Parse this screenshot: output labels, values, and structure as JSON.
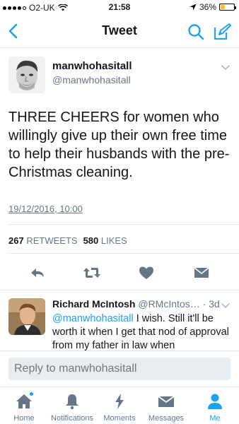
{
  "status_bar": {
    "carrier": "O2-UK",
    "time": "21:58",
    "battery": "36%",
    "battery_level": 0.36
  },
  "nav": {
    "title": "Tweet",
    "back_icon": "chevron-left-icon",
    "search_icon": "search-icon",
    "compose_icon": "compose-icon"
  },
  "tweet": {
    "name": "manwhohasitall",
    "handle": "@manwhohasitall",
    "text": "THREE CHEERS for women who willingly give up their own free time to help their husbands with the pre-Christmas cleaning.",
    "date": "19/12/2016, 10:00",
    "retweets_count": "267",
    "retweets_label": "RETWEETS",
    "likes_count": "580",
    "likes_label": "LIKES"
  },
  "reply": {
    "name": "Richard McIntosh",
    "handle": "@RMcIntos…",
    "time": "· 3d",
    "mention": "@manwhohasitall",
    "text": " I wish. Still it'll be worth it when I get that nod of approval from my father in law when"
  },
  "reply_bar": {
    "placeholder": "Reply to manwhohasitall"
  },
  "tabs": [
    {
      "label": "Home",
      "icon": "home-icon"
    },
    {
      "label": "Notifications",
      "icon": "bell-icon"
    },
    {
      "label": "Moments",
      "icon": "lightning-icon"
    },
    {
      "label": "Messages",
      "icon": "envelope-icon"
    },
    {
      "label": "Me",
      "icon": "person-icon"
    }
  ],
  "colors": {
    "accent": "#1da1f2",
    "muted": "#657786",
    "text": "#14171a",
    "divider": "#e1e8ed",
    "battery": "#f5c518"
  }
}
